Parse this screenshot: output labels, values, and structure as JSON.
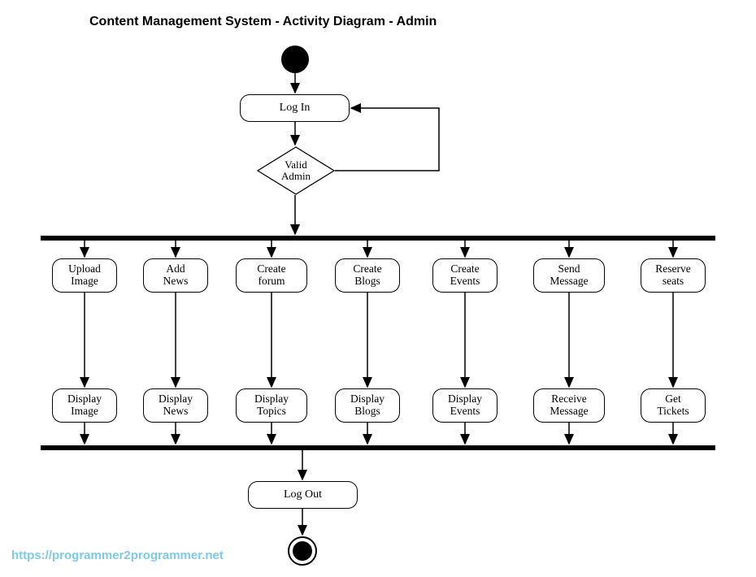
{
  "title": "Content Management System - Activity Diagram - Admin",
  "watermark": "https://programmer2programmer.net",
  "login": {
    "label": "Log In"
  },
  "decision": {
    "label": "Valid\nAdmin"
  },
  "logout": {
    "label": "Log Out"
  },
  "lanes": [
    {
      "top": "Upload\nImage",
      "bottom": "Display\nImage"
    },
    {
      "top": "Add\nNews",
      "bottom": "Display\nNews"
    },
    {
      "top": "Create\nforum",
      "bottom": "Display\nTopics"
    },
    {
      "top": "Create\nBlogs",
      "bottom": "Display\nBlogs"
    },
    {
      "top": "Create\nEvents",
      "bottom": "Display\nEvents"
    },
    {
      "top": "Send\nMessage",
      "bottom": "Receive\nMessage"
    },
    {
      "top": "Reserve\nseats",
      "bottom": "Get\nTickets"
    }
  ]
}
